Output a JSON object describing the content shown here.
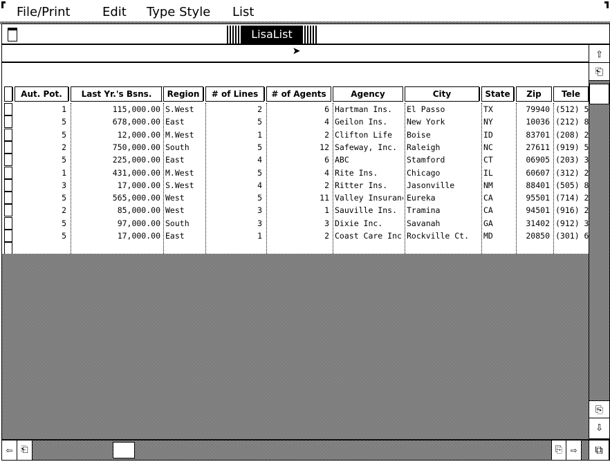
{
  "menubar": {
    "items": [
      "File/Print",
      "Edit",
      "Type Style",
      "List"
    ]
  },
  "window": {
    "title": "LisaList"
  },
  "table": {
    "columns": [
      "Aut. Pot.",
      "Last Yr.'s Bsns.",
      "Region",
      "# of Lines",
      "# of Agents",
      "Agency",
      "City",
      "State",
      "Zip",
      "Tele"
    ],
    "rows": [
      [
        "1",
        "115,000.00",
        "S.West",
        "2",
        "6",
        "Hartman Ins.",
        "El Passo",
        "TX",
        "79940",
        "(512) 5"
      ],
      [
        "5",
        "678,000.00",
        "East",
        "5",
        "4",
        "Geilon Ins.",
        "New York",
        "NY",
        "10036",
        "(212) 8"
      ],
      [
        "5",
        "12,000.00",
        "M.West",
        "1",
        "2",
        "Clifton Life",
        "Boise",
        "ID",
        "83701",
        "(208) 2"
      ],
      [
        "2",
        "750,000.00",
        "South",
        "5",
        "12",
        "Safeway, Inc.",
        "Raleigh",
        "NC",
        "27611",
        "(919) 5"
      ],
      [
        "5",
        "225,000.00",
        "East",
        "4",
        "6",
        "ABC",
        "Stamford",
        "CT",
        "06905",
        "(203) 3"
      ],
      [
        "1",
        "431,000.00",
        "M.West",
        "5",
        "4",
        "Rite Ins.",
        "Chicago",
        "IL",
        "60607",
        "(312) 2"
      ],
      [
        "3",
        "17,000.00",
        "S.West",
        "4",
        "2",
        "Ritter Ins.",
        "Jasonville",
        "NM",
        "88401",
        "(505) 8"
      ],
      [
        "5",
        "565,000.00",
        "West",
        "5",
        "11",
        "Valley Insurance",
        "Eureka",
        "CA",
        "95501",
        "(714) 2"
      ],
      [
        "2",
        "85,000.00",
        "West",
        "3",
        "1",
        "Sauville Ins.",
        "Tramina",
        "CA",
        "94501",
        "(916) 2"
      ],
      [
        "5",
        "97,000.00",
        "South",
        "3",
        "3",
        "Dixie Inc.",
        "Savanah",
        "GA",
        "31402",
        "(912) 3"
      ],
      [
        "5",
        "17,000.00",
        "East",
        "1",
        "2",
        "Coast Care Inc",
        "Rockville Ct.",
        "MD",
        "20850",
        "(301) 6"
      ]
    ]
  },
  "icons": {
    "close": "close-box-icon",
    "scroll_up": "arrow-up-icon",
    "scroll_down": "arrow-down-icon",
    "scroll_left": "arrow-left-icon",
    "scroll_right": "arrow-right-icon",
    "page": "page-icon",
    "resize": "size-box-icon",
    "cursor": "arrow-cursor-icon"
  }
}
